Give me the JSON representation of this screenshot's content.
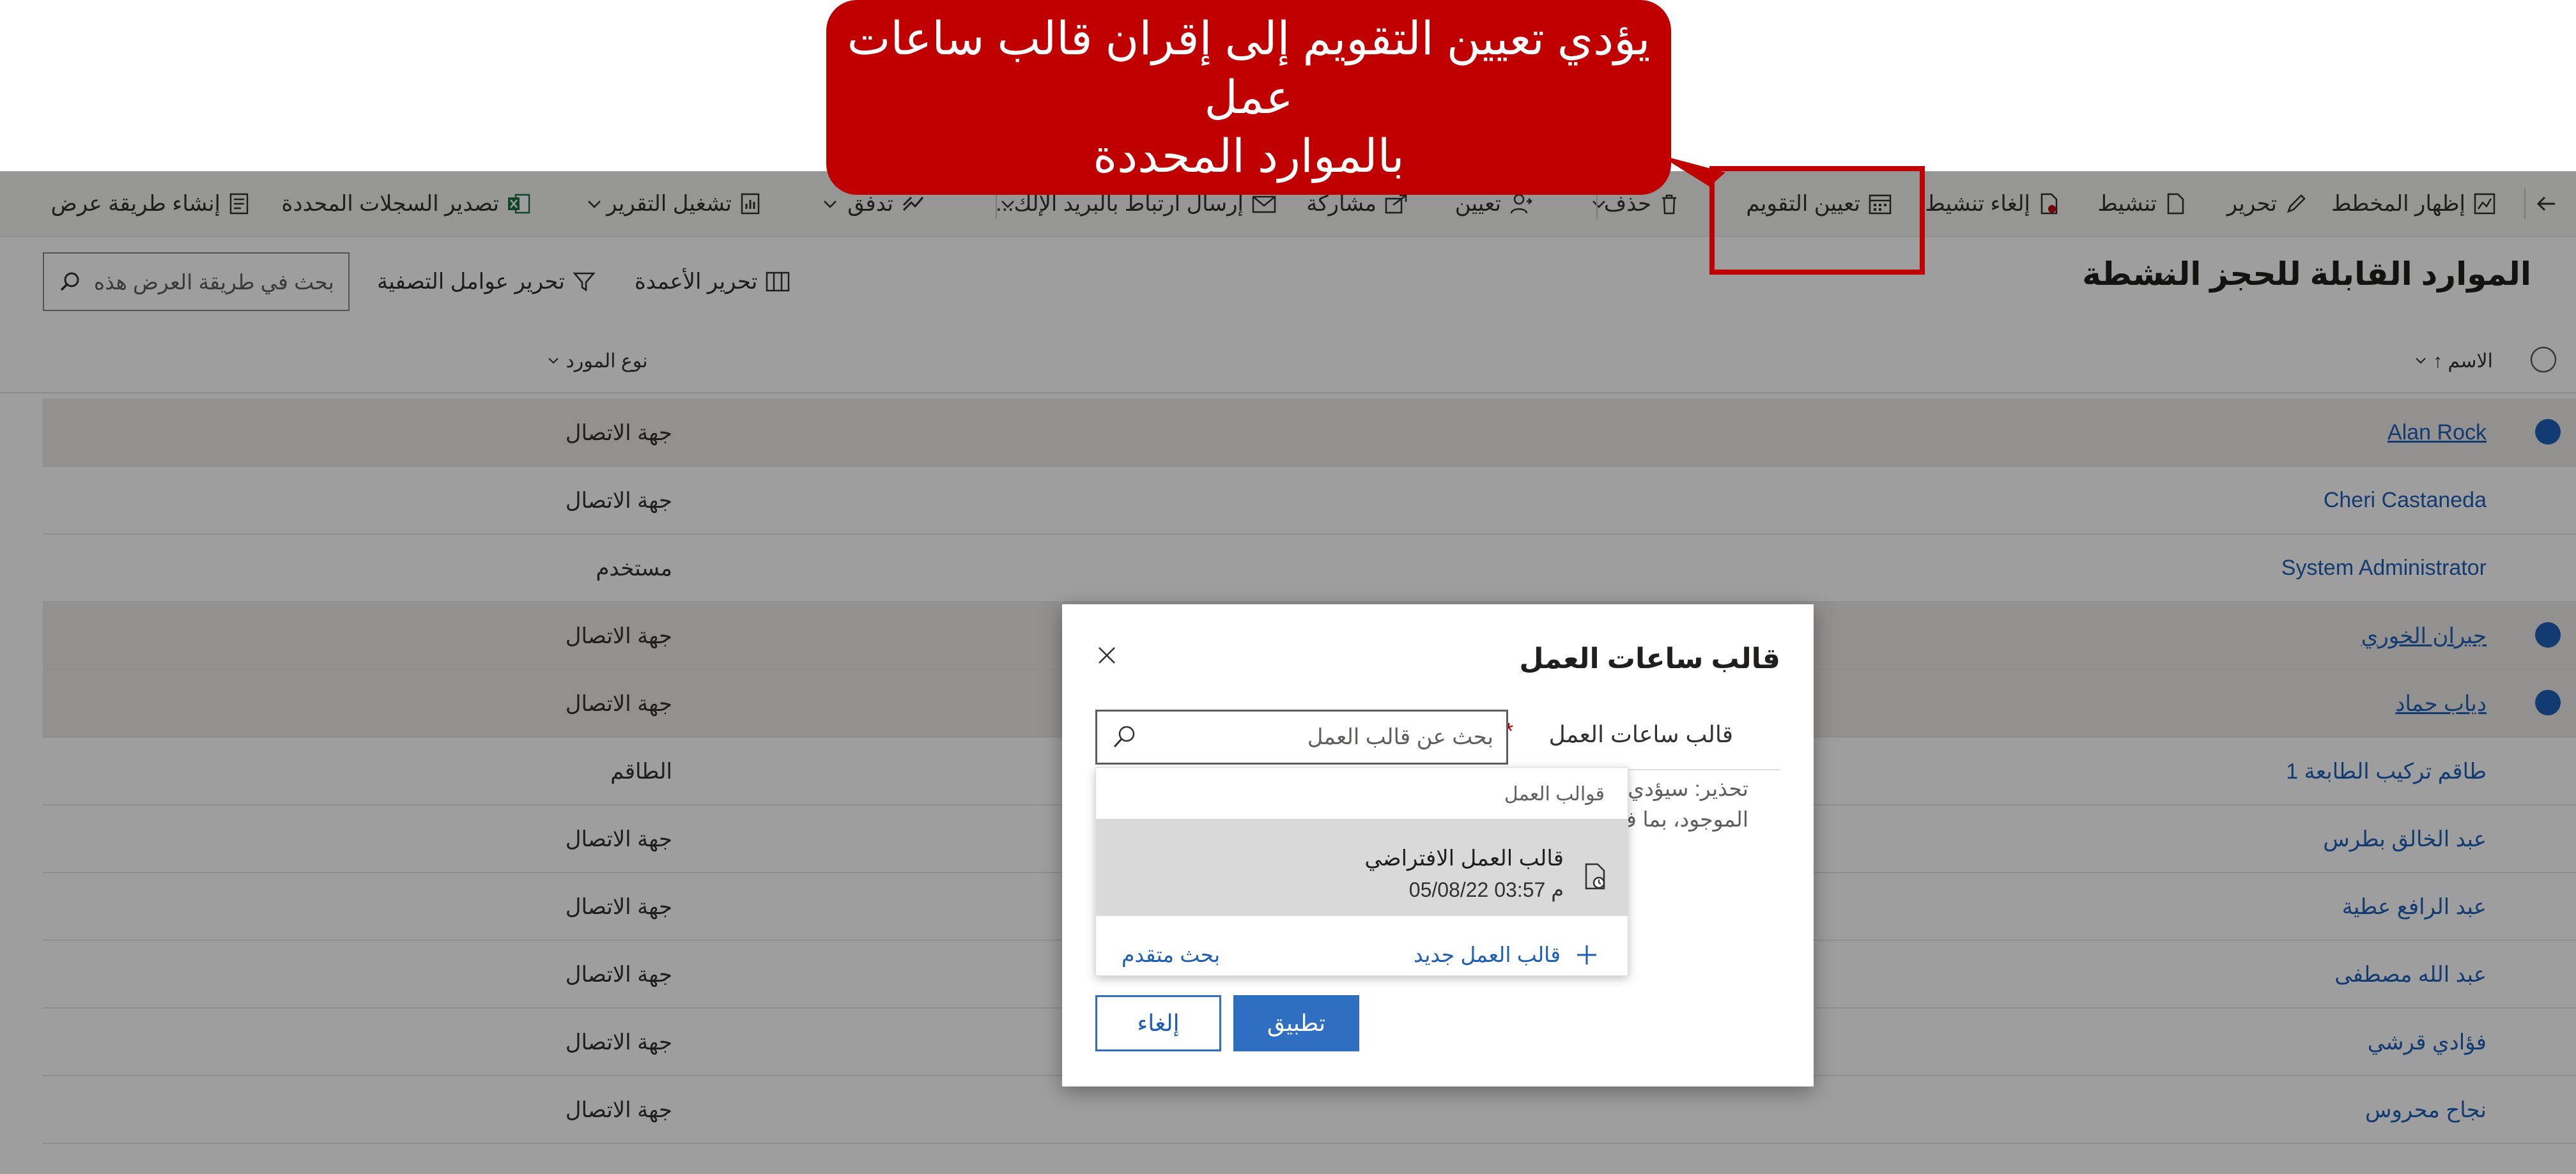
{
  "callout": {
    "line1": "يؤدي تعيين التقويم إلى إقران قالب ساعات عمل",
    "line2": "بالموارد المحددة"
  },
  "toolbar": {
    "back_icon": "arrow-back-icon",
    "show_chart": "إظهار المخطط",
    "edit": "تحرير",
    "activate": "تنشيط",
    "deactivate": "إلغاء تنشيط",
    "set_calendar": "تعيين التقويم",
    "delete": "حذف",
    "assign": "تعيين",
    "share": "مشاركة",
    "email_link": "إرسال ارتباط بالبريد الإلك...",
    "flow": "تدفق",
    "run_report": "تشغيل التقرير",
    "export_selected": "تصدير السجلات المحددة",
    "create_view": "إنشاء طريقة عرض"
  },
  "view": {
    "title": "الموارد القابلة للحجز النشطة",
    "edit_columns": "تحرير الأعمدة",
    "edit_filters": "تحرير عوامل التصفية",
    "search_placeholder": "بحث في طريقة العرض هذه"
  },
  "grid": {
    "col_name": "الاسم ↑",
    "col_type": "نوع المورد",
    "rows": [
      {
        "name": "Alan Rock",
        "type": "جهة الاتصال",
        "selected": true
      },
      {
        "name": "Cheri Castaneda",
        "type": "جهة الاتصال",
        "selected": false
      },
      {
        "name": "System Administrator",
        "type": "مستخدم",
        "selected": false
      },
      {
        "name": "جبران الخوري",
        "type": "جهة الاتصال",
        "selected": true
      },
      {
        "name": "دياب حماد",
        "type": "جهة الاتصال",
        "selected": true
      },
      {
        "name": "طاقم تركيب الطابعة 1",
        "type": "الطاقم",
        "selected": false
      },
      {
        "name": "عبد الخالق بطرس",
        "type": "جهة الاتصال",
        "selected": false
      },
      {
        "name": "عبد الرافع عطية",
        "type": "جهة الاتصال",
        "selected": false
      },
      {
        "name": "عبد الله مصطفى",
        "type": "جهة الاتصال",
        "selected": false
      },
      {
        "name": "فؤادي قرشي",
        "type": "جهة الاتصال",
        "selected": false
      },
      {
        "name": "نجاح محروس",
        "type": "جهة الاتصال",
        "selected": false
      }
    ]
  },
  "dialog": {
    "title": "قالب ساعات العمل",
    "field_label": "قالب ساعات العمل",
    "required_mark": "*",
    "input_placeholder": "بحث عن قالب العمل",
    "warning": "تحذير: سيؤدي ... الموجود، بما ف...",
    "dropdown_header": "قوالب العمل",
    "item_name": "قالب العمل الافتراضي",
    "item_date": "05/08/22 03:57 م",
    "new_template": "قالب العمل جديد",
    "advanced_search": "بحث متقدم",
    "apply": "تطبيق",
    "cancel": "إلغاء"
  },
  "colors": {
    "callout": "#c00000",
    "link": "#1d5fb8",
    "primary_button": "#2f6fc1"
  }
}
